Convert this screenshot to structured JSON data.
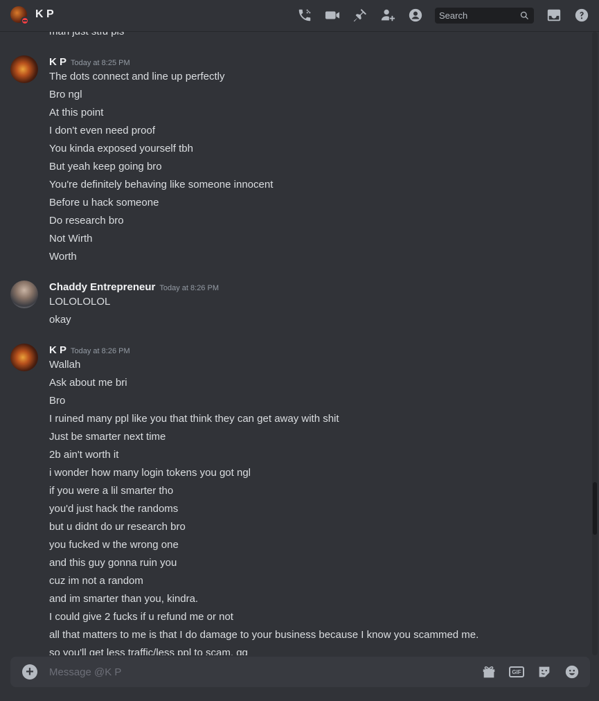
{
  "header": {
    "title": "K P",
    "search_placeholder": "Search",
    "icons": [
      "phone-call-icon",
      "video-camera-icon",
      "pin-icon",
      "add-friend-icon",
      "user-profile-icon",
      "inbox-icon",
      "help-icon"
    ]
  },
  "messages": {
    "cutoff_text": "man just stfu pls",
    "groups": [
      {
        "author": "K P",
        "timestamp": "Today at 8:25 PM",
        "lines": [
          "The dots connect and line up perfectly",
          "Bro ngl",
          "At this point",
          "I don't even need proof",
          "You kinda exposed yourself tbh",
          "But yeah keep going bro",
          "You're definitely behaving like someone innocent",
          "Before u hack someone",
          "Do research bro",
          "Not Wirth",
          "Worth"
        ]
      },
      {
        "author": "Chaddy Entrepreneur",
        "timestamp": "Today at 8:26 PM",
        "lines": [
          "LOLOLOLOL",
          "okay"
        ]
      },
      {
        "author": "K P",
        "timestamp": "Today at 8:26 PM",
        "lines": [
          "Wallah",
          "Ask about me bri",
          "Bro",
          "I ruined many ppl like you that think they can get away with shit",
          "Just be smarter next time",
          "2b ain't worth it",
          "i wonder how many login tokens you got ngl",
          "if you were a lil smarter tho",
          "you'd just hack the randoms",
          "but u didnt do ur research bro",
          "you fucked w the wrong one",
          "and this guy gonna ruin you",
          "cuz im not a random",
          "and im smarter than you, kindra.",
          "I could give 2 fucks if u refund me or not",
          "all that matters to me is that I do damage to your business because I know you scammed me.",
          "so you'll get less traffic/less ppl to scam. gg"
        ]
      }
    ]
  },
  "composer": {
    "placeholder": "Message @K P",
    "icons": [
      "add-attachment-icon",
      "gift-icon",
      "gif-icon",
      "sticker-icon",
      "emoji-icon"
    ],
    "gif_label": "GIF"
  },
  "colors": {
    "background": "#313338",
    "text": "#dbdee1",
    "username": "#f2f3f5",
    "timestamp": "#949ba4",
    "dnd_status": "#f23f43"
  }
}
